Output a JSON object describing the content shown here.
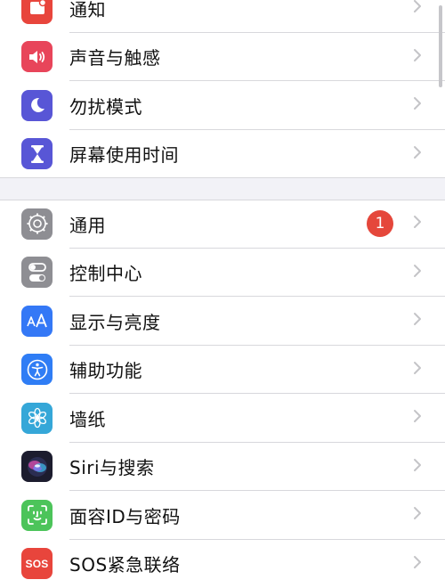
{
  "top_group": {
    "items": [
      {
        "id": "notifications",
        "label": "通知",
        "icon": "notifications-icon",
        "color": "#e8453c"
      },
      {
        "id": "sounds",
        "label": "声音与触感",
        "icon": "speaker-icon",
        "color": "#e8455a"
      },
      {
        "id": "dnd",
        "label": "勿扰模式",
        "icon": "moon-icon",
        "color": "#5856d6"
      },
      {
        "id": "screen_time",
        "label": "屏幕使用时间",
        "icon": "hourglass-icon",
        "color": "#5856d6"
      }
    ]
  },
  "main_group": {
    "items": [
      {
        "id": "general",
        "label": "通用",
        "icon": "gear-icon",
        "color": "#8e8e93",
        "badge": "1"
      },
      {
        "id": "control_center",
        "label": "控制中心",
        "icon": "toggles-icon",
        "color": "#8e8e93"
      },
      {
        "id": "display",
        "label": "显示与亮度",
        "icon": "text-size-icon",
        "color": "#3478f6"
      },
      {
        "id": "accessibility",
        "label": "辅助功能",
        "icon": "accessibility-icon",
        "color": "#2f7df5"
      },
      {
        "id": "wallpaper",
        "label": "墙纸",
        "icon": "flower-icon",
        "color": "#35a7d8"
      },
      {
        "id": "siri",
        "label": "Siri与搜索",
        "icon": "siri-icon",
        "color": "#1c1c2e"
      },
      {
        "id": "faceid",
        "label": "面容ID与密码",
        "icon": "face-id-icon",
        "color": "#4cc45a"
      },
      {
        "id": "sos",
        "label": "SOS紧急联络",
        "icon": "sos-icon",
        "color": "#e8453c",
        "icon_text": "SOS"
      }
    ]
  },
  "colors": {
    "background": "#f2f2f7",
    "separator": "#d8d8dc",
    "badge": "#e5473b",
    "chevron": "#c4c4c7"
  }
}
